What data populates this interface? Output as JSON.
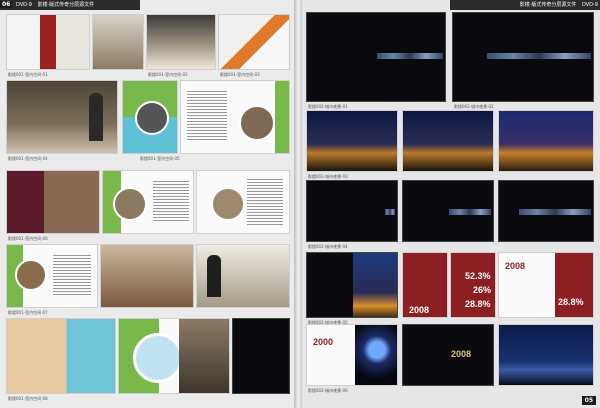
{
  "header_left": {
    "page_number": "06",
    "dvd": "DVD-9",
    "title": "影楼·版式传奇分层源文件"
  },
  "header_right": {
    "dvd": "DVD-9",
    "title": "影楼·版式传奇分层源文件",
    "page_number": "05"
  },
  "left_captions": [
    "影楼001-室内空间-01",
    "影楼001-室内空间-02",
    "影楼001-室内空间-03",
    "影楼001-室内空间-04",
    "影楼001-室内空间-05",
    "影楼001-室内空间-06",
    "影楼001-室内空间-07",
    "影楼001-室内空间-08",
    "影楼001-室内空间-09",
    "影楼001-室内空间-10",
    "影楼001-室内空间-11",
    "影楼001-室内空间-12",
    "影楼001-室内空间-13",
    "影楼001-室内空间-14",
    "影楼001-室内空间-15"
  ],
  "right_captions": [
    "影楼002-城市夜景-01",
    "影楼002-城市夜景-02",
    "影楼002-城市夜景-03",
    "影楼002-城市夜景-04",
    "影楼002-城市夜景-05",
    "影楼002-城市夜景-06",
    "影楼002-城市夜景-07",
    "影楼002-城市夜景-08",
    "影楼002-城市夜景-09",
    "影楼002-城市夜景-10",
    "影楼002-城市夜景-11",
    "影楼002-城市夜景-12",
    "影楼002-城市夜景-13",
    "影楼002-城市夜景-14",
    "影楼002-城市夜景-15"
  ],
  "stats": {
    "pct1": "52.3%",
    "pct2": "26%",
    "pct3": "28.8%",
    "pct4": "28.8%",
    "year1": "2008",
    "year2": "2008",
    "year3": "2000",
    "year4": "2008"
  },
  "colors": {
    "accent_green": "#79b84a",
    "accent_cyan": "#5ec1d6",
    "accent_red": "#8c1f22",
    "dark": "#0a0a0e"
  }
}
